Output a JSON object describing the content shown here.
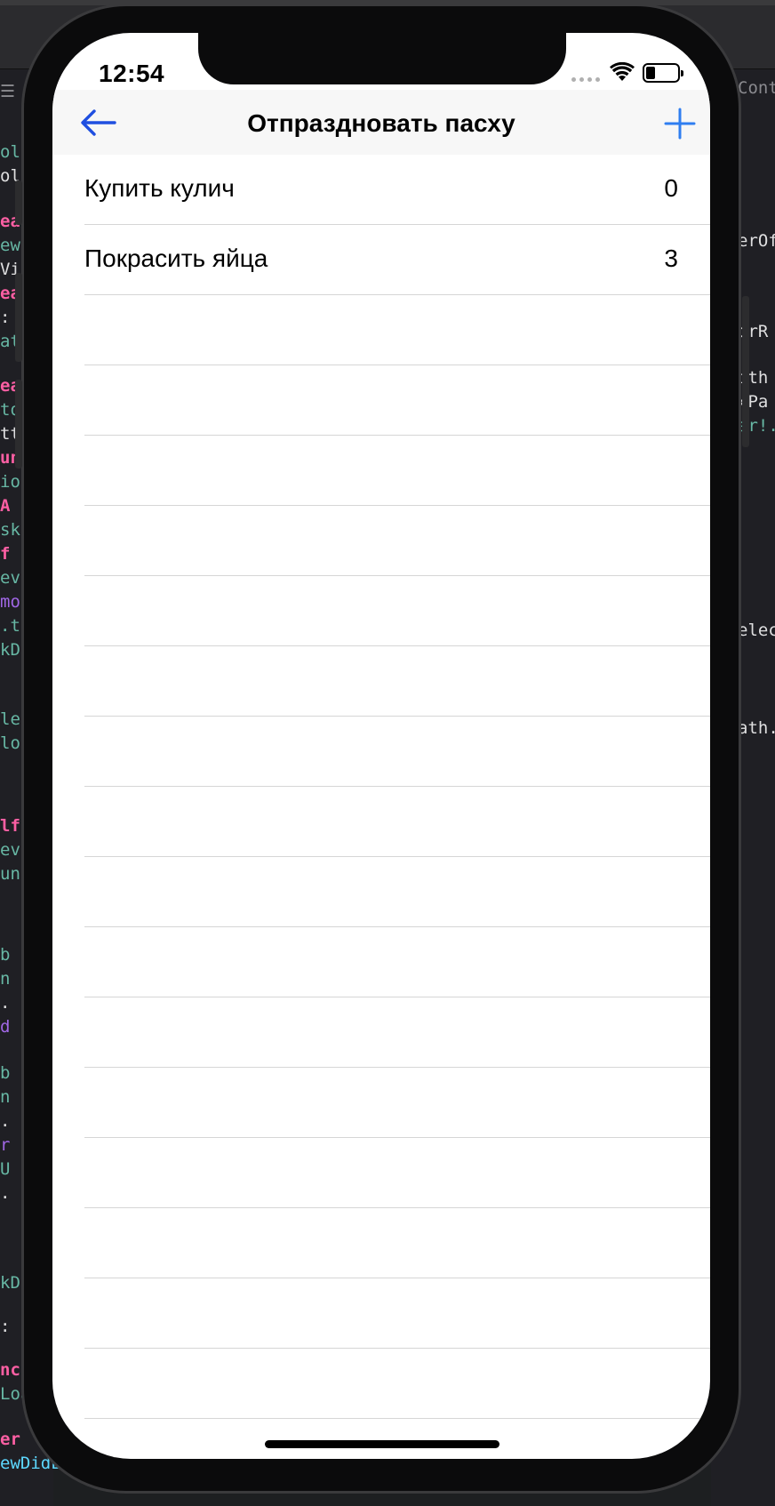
{
  "app": {
    "accent_color": "#2f6fe0"
  },
  "status_bar": {
    "time": "12:54"
  },
  "nav": {
    "title": "Отпраздновать пасху",
    "back_icon": "arrow-left-icon",
    "add_icon": "plus-icon"
  },
  "tasks": [
    {
      "label": "Купить кулич",
      "count": "0"
    },
    {
      "label": "Покрасить яйца",
      "count": "3"
    }
  ],
  "background_code": {
    "left": [
      "ol",
      "ol",
      "ea",
      "ew",
      "Vi",
      "ea",
      ":",
      "at",
      "ea",
      "to",
      "tt",
      "un",
      "io",
      "A",
      "sk",
      "f",
      "ev",
      "mo",
      ".t",
      "kD",
      "le",
      "lo",
      "lf",
      "ev",
      "un",
      "b",
      "n",
      ".",
      "d",
      "b",
      "n",
      ".",
      "r",
      "U",
      ".",
      "kD",
      ":",
      "nc",
      "Loa",
      "er",
      "ewDidLoad"
    ],
    "right": [
      "Cont",
      "erOf",
      "orR",
      "ith",
      "xPa",
      "ar!.",
      "elec",
      "ath."
    ]
  }
}
